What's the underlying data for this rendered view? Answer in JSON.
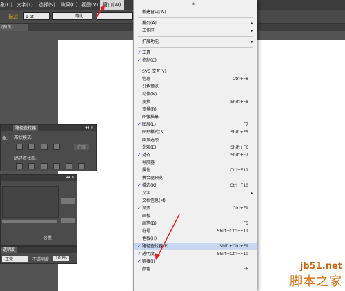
{
  "menubar": {
    "items": [
      "象(O)",
      "文字(T)",
      "选择(S)",
      "效果(C)",
      "视图(V)",
      "窗口(W)"
    ],
    "active": "窗口(W)"
  },
  "control": {
    "stroke_label": "描边",
    "stroke_width": "1 pt",
    "profile_label": "等比",
    "brush_label": "基"
  },
  "doc_tab": "(预览)",
  "panels": {
    "pathfinder": {
      "tab": "路径查找器",
      "shape_modes": "形状模式:",
      "pathfinders": "路径查找器:",
      "expand": "扩展",
      "side_label": "象:"
    },
    "transparency": {
      "tab": "透明度",
      "mode": "正常",
      "opacity_label": "不透明度",
      "opacity_value": "100%",
      "side_label": "容量"
    }
  },
  "window_menu": {
    "items": [
      {
        "label": "新建窗口(W)",
        "shortcut": "",
        "checked": false,
        "submenu": false
      },
      {
        "sep": true
      },
      {
        "label": "排列(A)",
        "shortcut": "",
        "checked": false,
        "submenu": true
      },
      {
        "label": "工作区",
        "shortcut": "",
        "checked": false,
        "submenu": true
      },
      {
        "sep": true
      },
      {
        "label": "扩展功能",
        "shortcut": "",
        "checked": false,
        "submenu": true
      },
      {
        "sep": true
      },
      {
        "label": "工具",
        "shortcut": "",
        "checked": true,
        "submenu": false
      },
      {
        "label": "控制(C)",
        "shortcut": "",
        "checked": true,
        "submenu": false
      },
      {
        "sep": true
      },
      {
        "label": "SVG 交互(Y)",
        "shortcut": "",
        "checked": false,
        "submenu": false
      },
      {
        "label": "信息",
        "shortcut": "Ctrl+F8",
        "checked": false,
        "submenu": false
      },
      {
        "label": "分色预览",
        "shortcut": "",
        "checked": false,
        "submenu": false
      },
      {
        "label": "动作(N)",
        "shortcut": "",
        "checked": false,
        "submenu": false
      },
      {
        "label": "变换",
        "shortcut": "Shift+F8",
        "checked": false,
        "submenu": false
      },
      {
        "label": "变量(R)",
        "shortcut": "",
        "checked": false,
        "submenu": false
      },
      {
        "label": "图像描摹",
        "shortcut": "",
        "checked": false,
        "submenu": false
      },
      {
        "label": "图层(L)",
        "shortcut": "F7",
        "checked": true,
        "submenu": false
      },
      {
        "label": "图形样式(S)",
        "shortcut": "Shift+F5",
        "checked": false,
        "submenu": false
      },
      {
        "label": "图案选项",
        "shortcut": "",
        "checked": false,
        "submenu": false
      },
      {
        "label": "外观(E)",
        "shortcut": "Shift+F6",
        "checked": false,
        "submenu": false
      },
      {
        "label": "对齐",
        "shortcut": "Shift+F7",
        "checked": true,
        "submenu": false
      },
      {
        "label": "导航器",
        "shortcut": "",
        "checked": false,
        "submenu": false
      },
      {
        "label": "属性",
        "shortcut": "Ctrl+F11",
        "checked": false,
        "submenu": false
      },
      {
        "label": "拼合器预览",
        "shortcut": "",
        "checked": false,
        "submenu": false
      },
      {
        "label": "描边(K)",
        "shortcut": "Ctrl+F10",
        "checked": true,
        "submenu": false
      },
      {
        "label": "文字",
        "shortcut": "",
        "checked": false,
        "submenu": true
      },
      {
        "label": "文档信息(M)",
        "shortcut": "",
        "checked": false,
        "submenu": false
      },
      {
        "label": "渐变",
        "shortcut": "Ctrl+F9",
        "checked": true,
        "submenu": false
      },
      {
        "label": "画板",
        "shortcut": "",
        "checked": false,
        "submenu": false
      },
      {
        "label": "画笔(B)",
        "shortcut": "F5",
        "checked": false,
        "submenu": false
      },
      {
        "label": "符号",
        "shortcut": "Shift+Ctrl+F11",
        "checked": false,
        "submenu": false
      },
      {
        "label": "色板(H)",
        "shortcut": "",
        "checked": false,
        "submenu": false
      },
      {
        "label": "路径查找器(P)",
        "shortcut": "Shift+Ctrl+F9",
        "checked": true,
        "submenu": false,
        "highlight": true
      },
      {
        "label": "透明度",
        "shortcut": "Shift+Ctrl+F10",
        "checked": true,
        "submenu": false
      },
      {
        "label": "链接(I)",
        "shortcut": "",
        "checked": true,
        "submenu": false
      },
      {
        "label": "颜色",
        "shortcut": "F6",
        "checked": false,
        "submenu": false
      }
    ]
  },
  "watermark": {
    "site": "jb51.net",
    "name": "脚本之家"
  },
  "colors": {
    "annotation_arrow": "#e02020",
    "check": "#1a4fd8",
    "highlight": "#c7d7ef"
  }
}
